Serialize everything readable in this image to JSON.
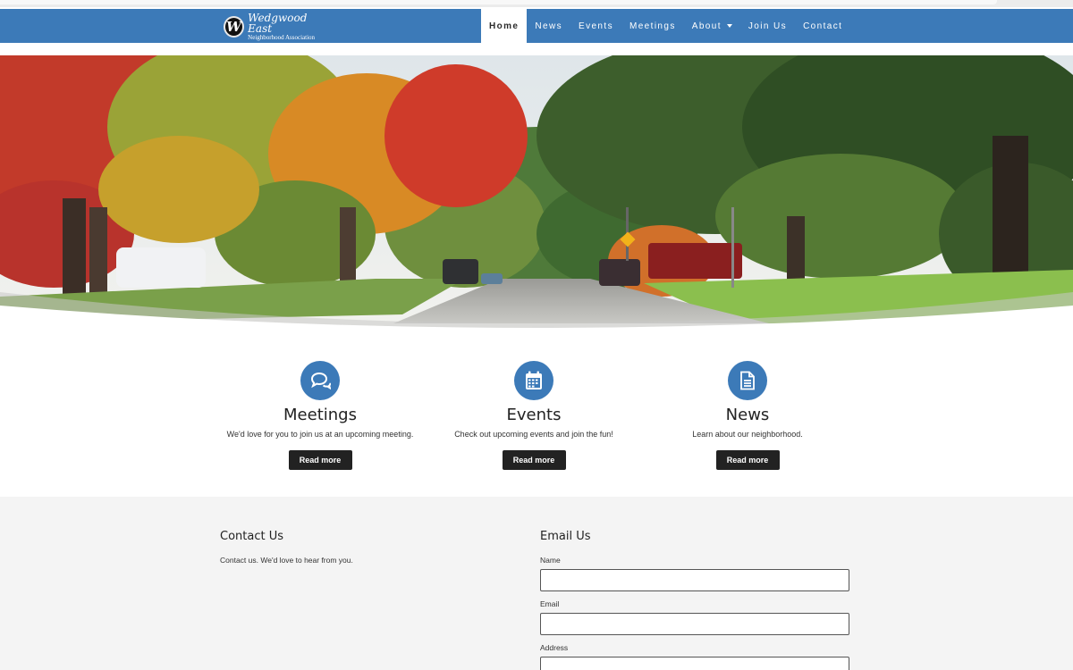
{
  "brand": {
    "logo_letter": "W",
    "title": "Wedgwood East",
    "subtitle": "Neighborhood Association"
  },
  "nav": {
    "home": "Home",
    "news": "News",
    "events": "Events",
    "meetings": "Meetings",
    "about": "About",
    "join": "Join Us",
    "contact": "Contact"
  },
  "features": [
    {
      "icon": "chat-bubbles-icon",
      "title": "Meetings",
      "description": "We'd love for you to join us at an upcoming meeting.",
      "button": "Read more"
    },
    {
      "icon": "calendar-icon",
      "title": "Events",
      "description": "Check out upcoming events and join the fun!",
      "button": "Read more"
    },
    {
      "icon": "document-icon",
      "title": "News",
      "description": "Learn about our neighborhood.",
      "button": "Read more"
    }
  ],
  "contact": {
    "heading": "Contact Us",
    "text": "Contact us. We'd love to hear from you."
  },
  "email_form": {
    "heading": "Email Us",
    "name_label": "Name",
    "email_label": "Email",
    "address_label": "Address"
  },
  "colors": {
    "primary": "#3c7ab8",
    "button": "#222222",
    "section_bg": "#f4f4f4"
  }
}
